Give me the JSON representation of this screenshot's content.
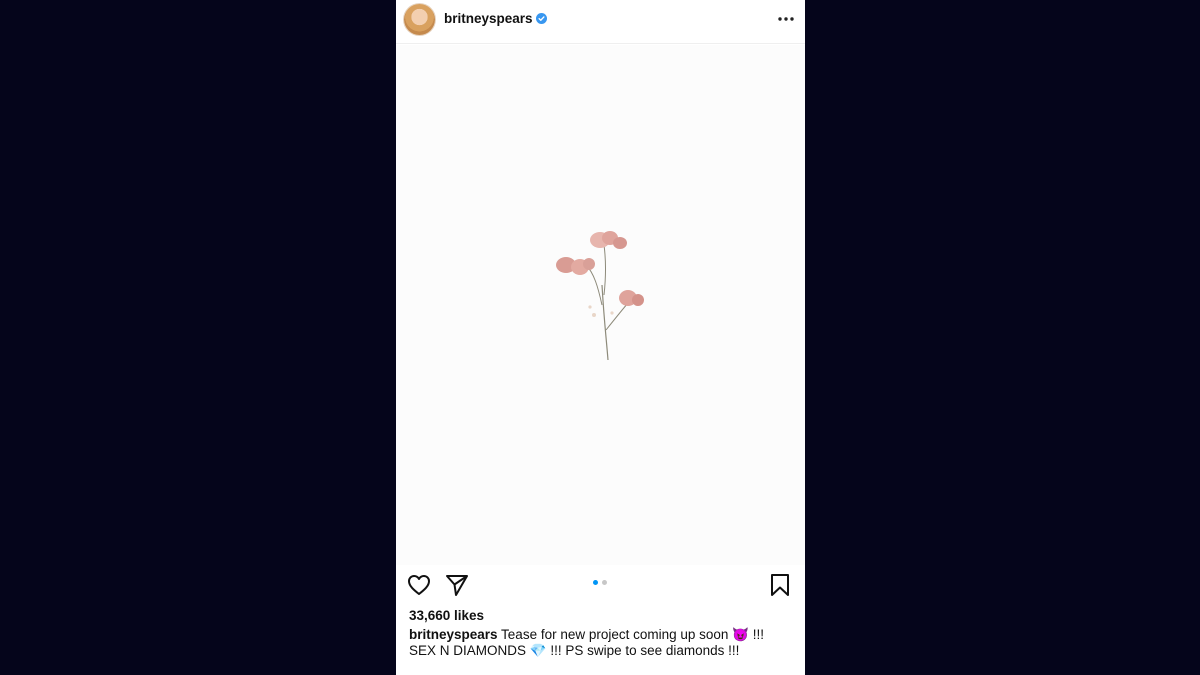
{
  "post": {
    "username": "britneyspears",
    "verified_icon": "verified-badge-icon",
    "more_icon": "more-options-icon",
    "likes": "33,660 likes",
    "caption_user": "britneyspears",
    "caption_text": " Tease for new project coming up soon 😈 !!! SEX N DIAMONDS 💎 !!! PS swipe to see diamonds !!!",
    "carousel": {
      "count": 2,
      "active_index": 0
    }
  },
  "actions": {
    "like_icon": "heart-icon",
    "share_icon": "send-icon",
    "save_icon": "bookmark-icon"
  },
  "colors": {
    "background": "#05051b",
    "verified": "#3897f0",
    "dot_active": "#0095f6",
    "dot_inactive": "#c7c7c7"
  }
}
